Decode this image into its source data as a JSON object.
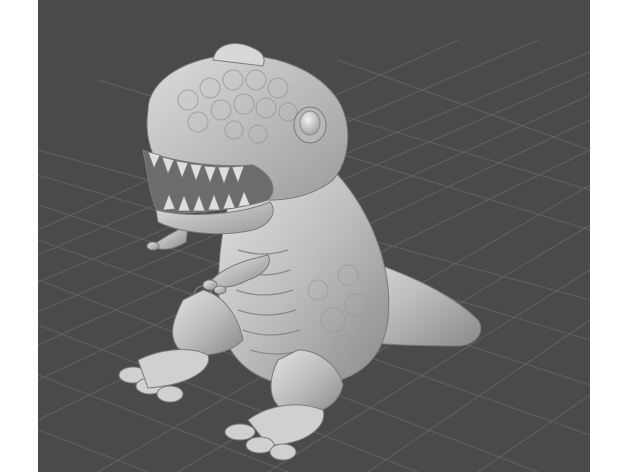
{
  "viewer": {
    "background_color": "#4a4a4a",
    "grid_color": "#6a6a6a",
    "model_color": "#c8c8c8",
    "model_shadow_color": "#8c8c8c",
    "model": "dinosaur-sculpture",
    "grid_visible": true
  }
}
